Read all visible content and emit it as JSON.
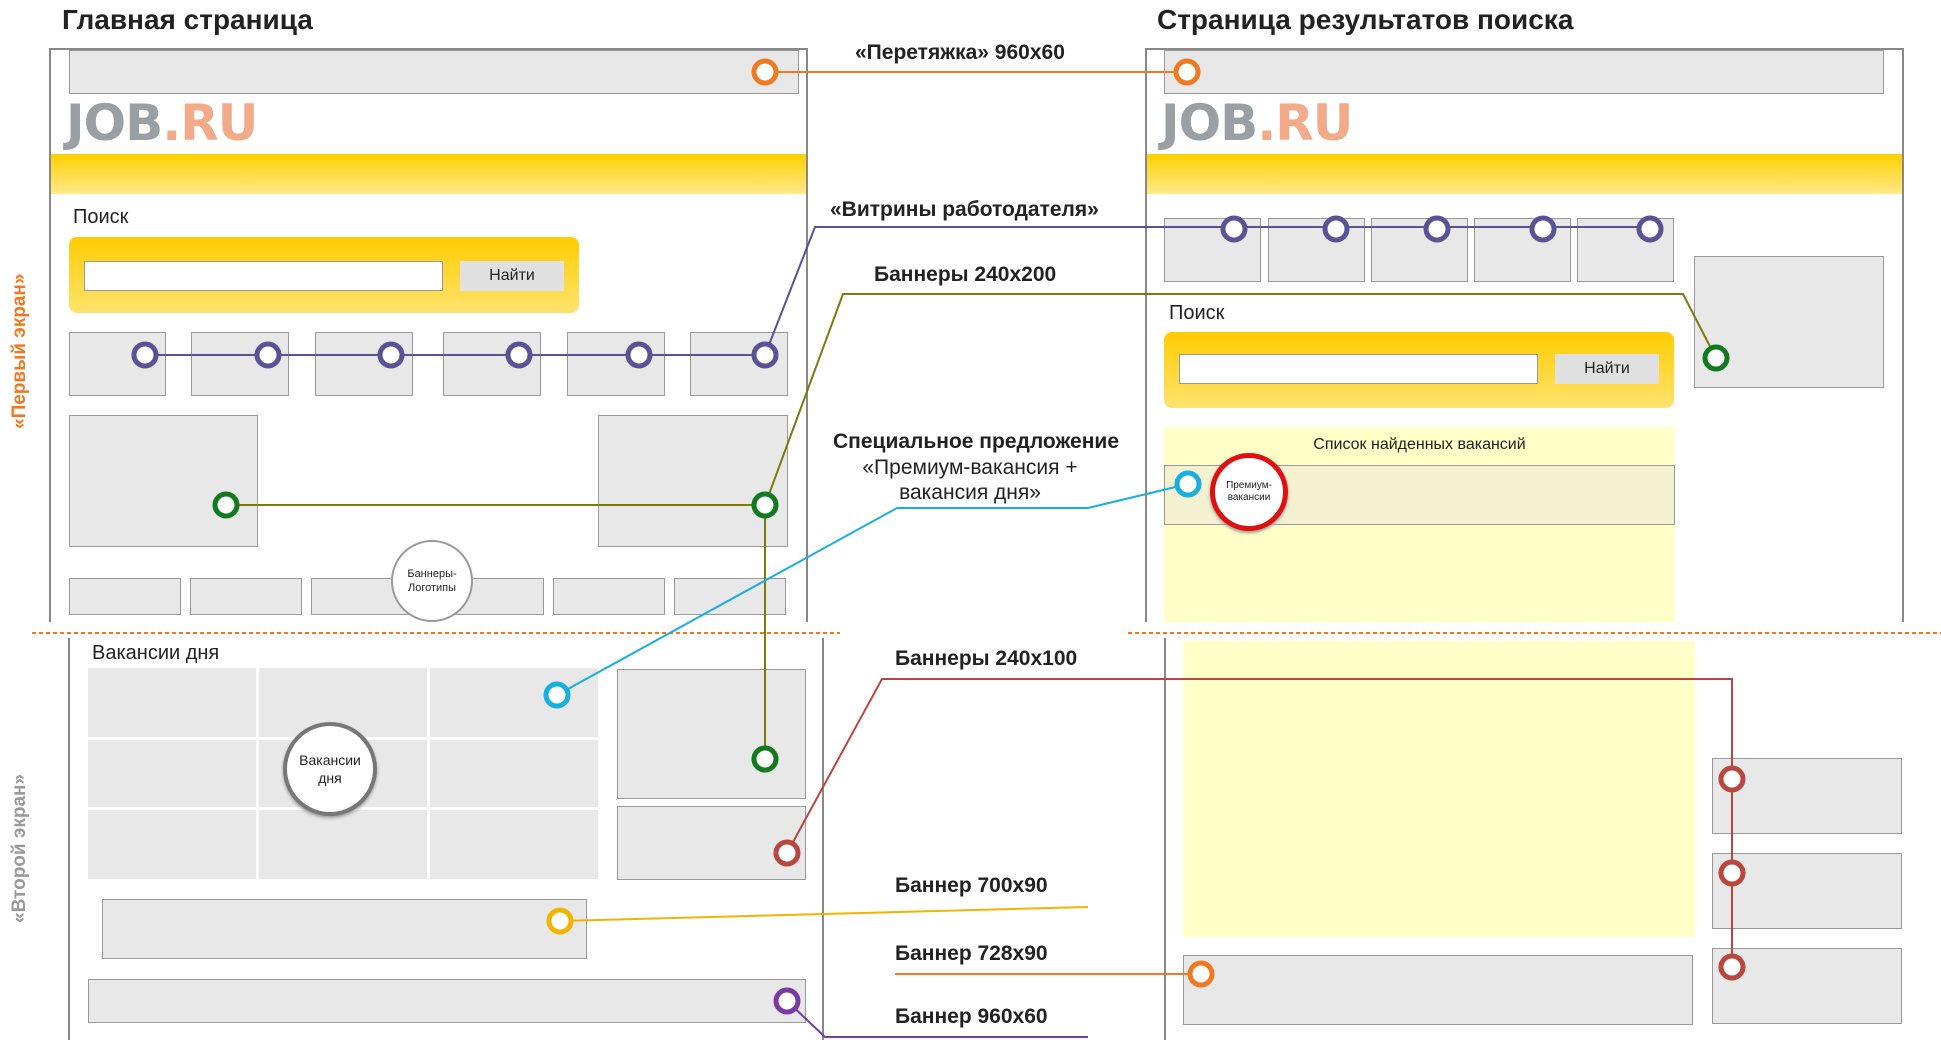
{
  "titles": {
    "main_page": "Главная страница",
    "search_results_page": "Страница результатов поиска"
  },
  "side_labels": {
    "first_screen": "«Первый экран»",
    "second_screen": "«Второй экран»"
  },
  "logo": {
    "part1": "JOB",
    "part2": ".RU"
  },
  "search": {
    "label": "Поиск",
    "button": "Найти"
  },
  "labels": {
    "stretch": "«Перетяжка» 960x60",
    "showcases": "«Витрины работодателя»",
    "banners_240x200": "Баннеры 240x200",
    "special_offer_title": "Специальное предложение",
    "special_offer_line1": "«Премиум-вакансия +",
    "special_offer_line2": "вакансия дня»",
    "banners_240x100": "Баннеры 240x100",
    "banner_700x90": "Баннер 700x90",
    "banner_728x90": "Баннер 728x90",
    "banner_960x60": "Баннер 960x60"
  },
  "main": {
    "logo_banners_line1": "Баннеры-",
    "logo_banners_line2": "Логотипы",
    "vacancies_of_day_title": "Вакансии дня",
    "vacancies_of_day_circle_line1": "Вакансии",
    "vacancies_of_day_circle_line2": "дня"
  },
  "results": {
    "found_list_title": "Список найденных вакансий",
    "premium_line1": "Премиум-",
    "premium_line2": "вакансии"
  },
  "colors": {
    "orange": "#f07820",
    "purple": "#5a5296",
    "green": "#117a1e",
    "olive": "#7b7b10",
    "cyan": "#18aee0",
    "red": "#b9473f",
    "yellow": "#f2b400",
    "violet": "#7a3aa4",
    "divider": "#f07820",
    "premium_red": "#e01010"
  }
}
